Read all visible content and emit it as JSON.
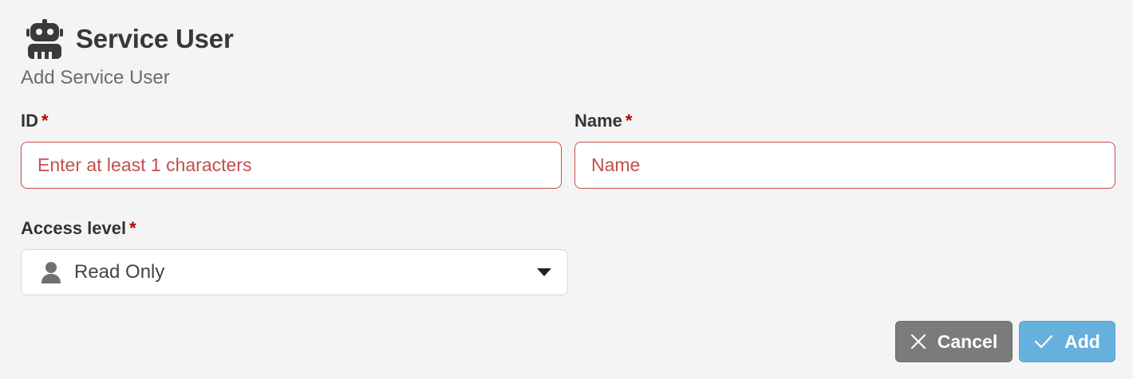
{
  "header": {
    "title": "Service User",
    "icon": "robot-icon"
  },
  "subtitle": "Add Service User",
  "required_marker": "*",
  "form": {
    "id": {
      "label": "ID",
      "placeholder": "Enter at least 1 characters",
      "value": ""
    },
    "name": {
      "label": "Name",
      "placeholder": "Name",
      "value": ""
    },
    "access_level": {
      "label": "Access level",
      "selected": "Read Only",
      "icon": "user-icon"
    }
  },
  "buttons": {
    "cancel": {
      "label": "Cancel",
      "icon": "close-icon"
    },
    "add": {
      "label": "Add",
      "icon": "check-icon"
    }
  },
  "colors": {
    "background": "#f4f4f4",
    "error": "#c84c4c",
    "required": "#b30000",
    "cancel_button": "#7b7b7b",
    "add_button": "#66b0de"
  }
}
